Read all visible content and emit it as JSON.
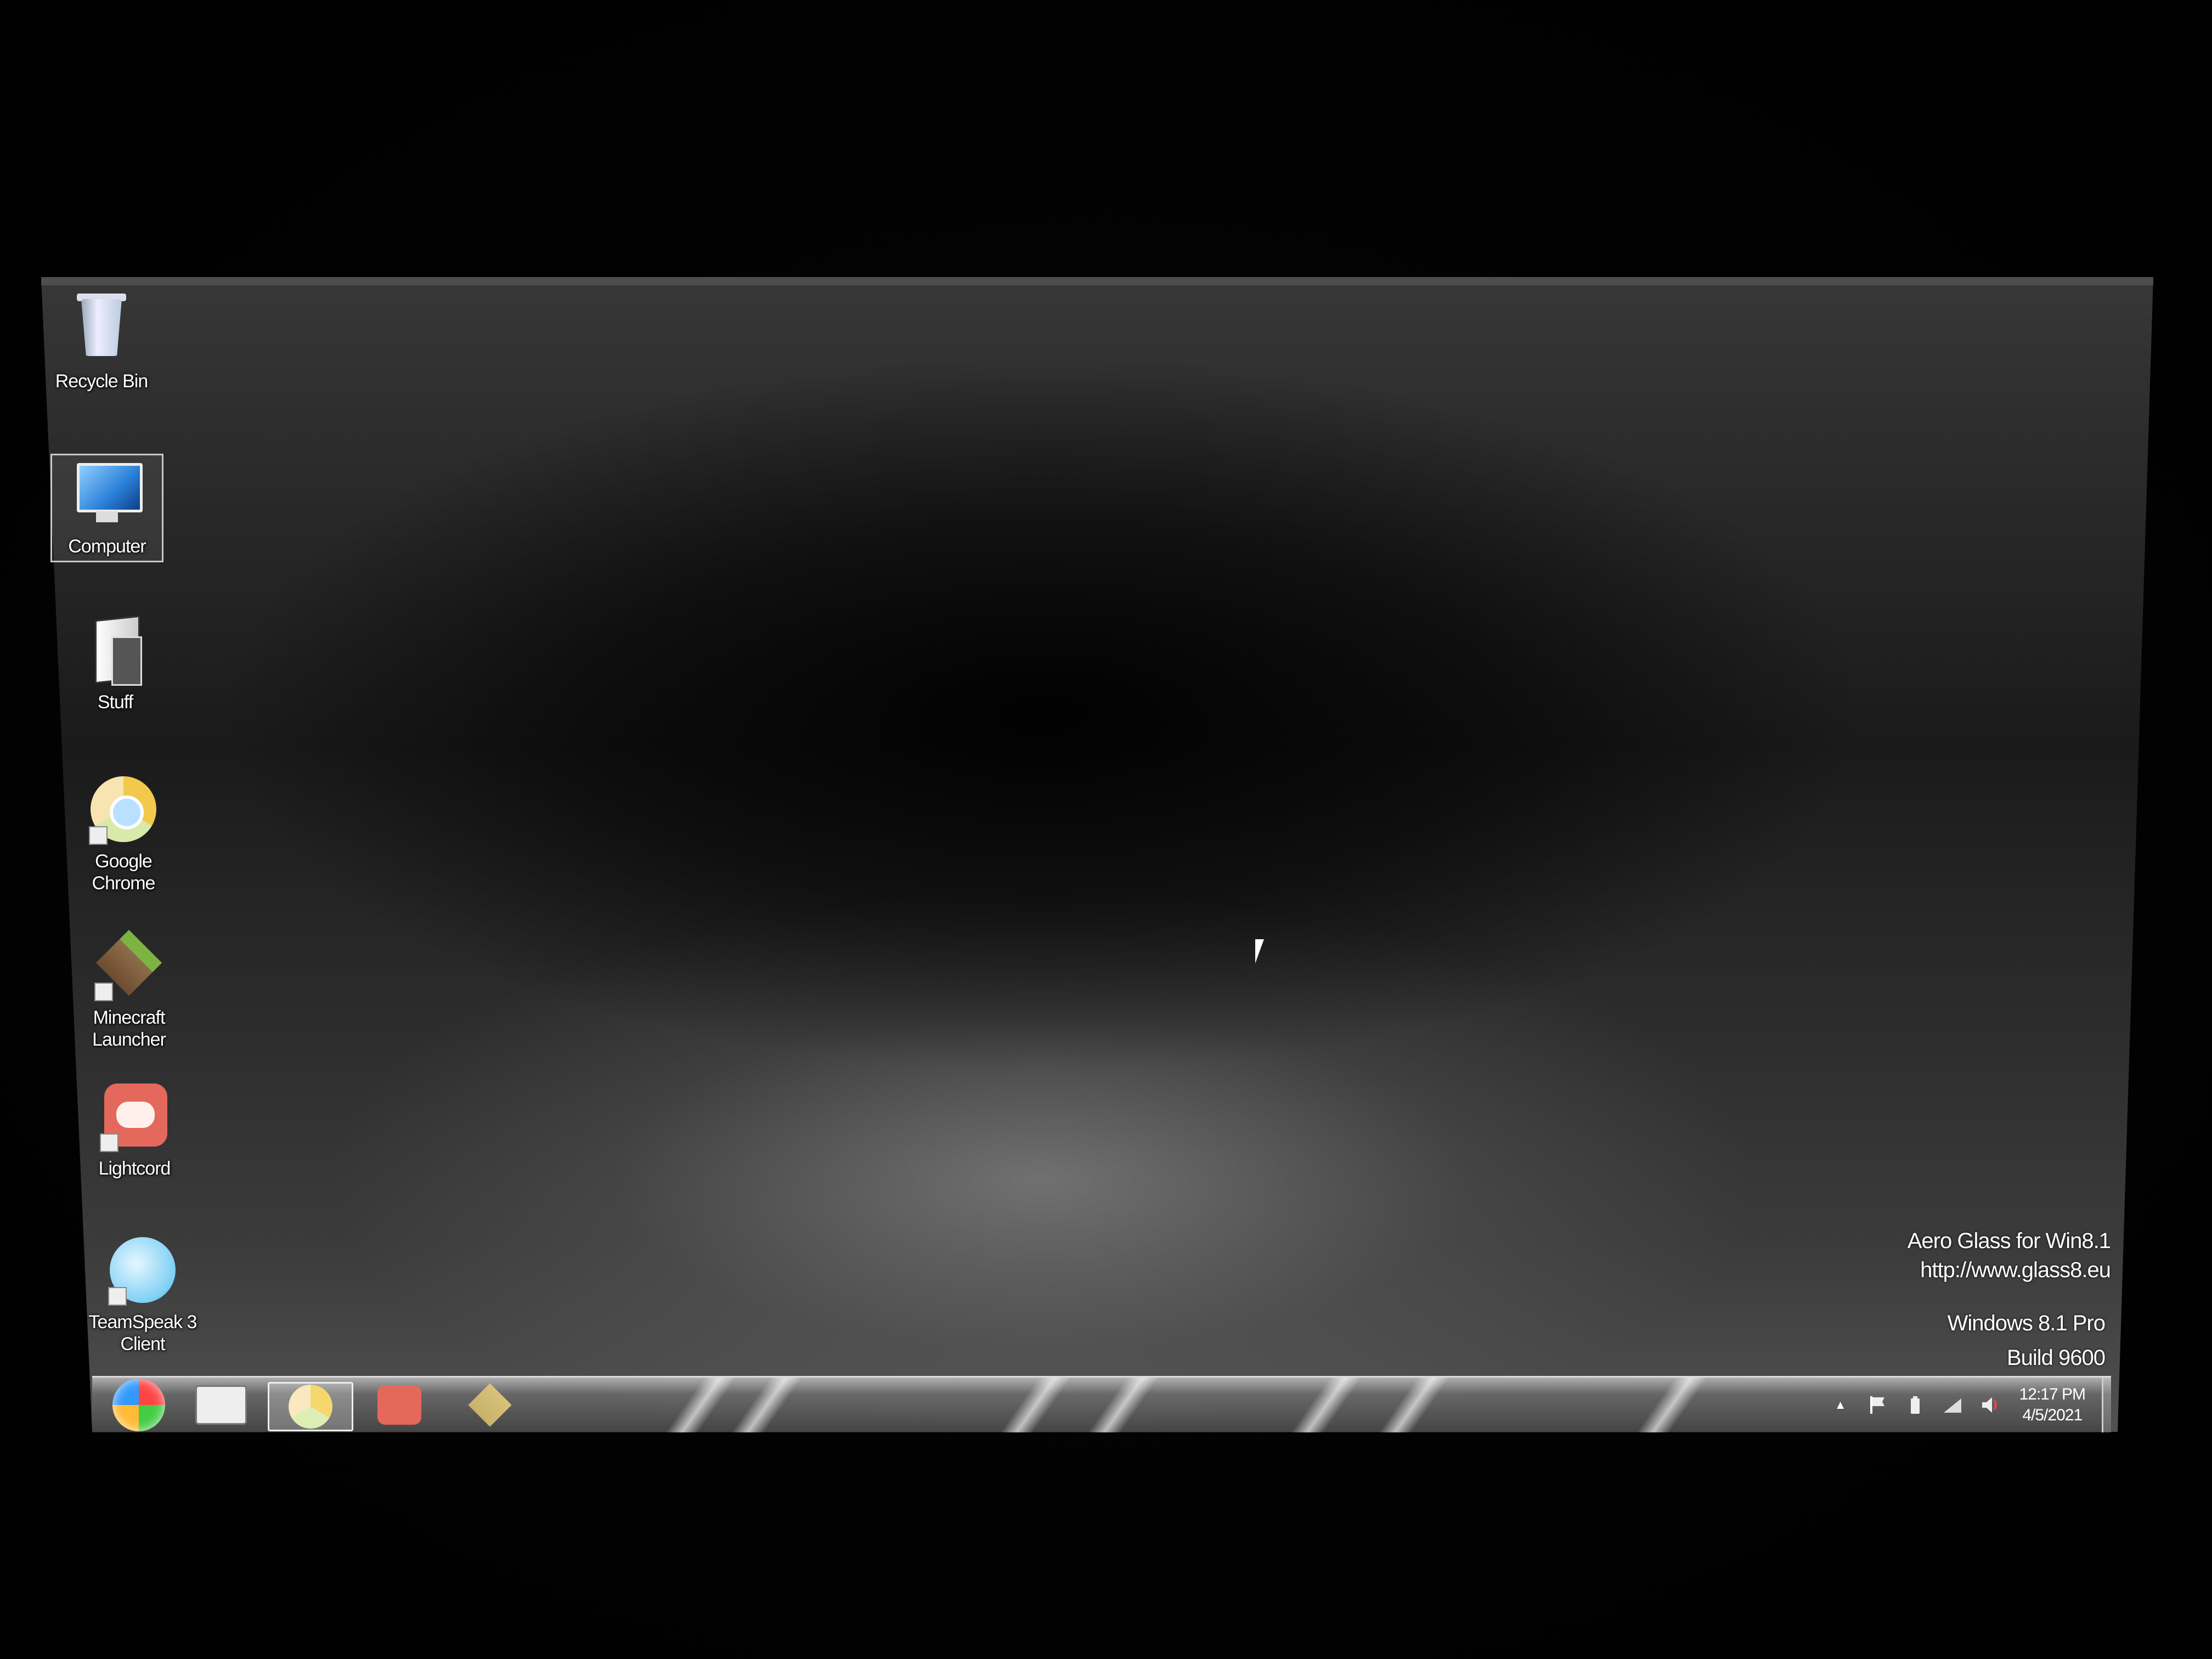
{
  "desktop": {
    "icons": [
      {
        "label": "Recycle Bin",
        "icon": "recycle-bin-icon"
      },
      {
        "label": "Computer",
        "icon": "computer-icon",
        "selected": true
      },
      {
        "label": "Stuff",
        "icon": "folder-shortcut-icon"
      },
      {
        "label_line1": "Google",
        "label_line2": "Chrome",
        "icon": "chrome-icon"
      },
      {
        "label_line1": "Minecraft",
        "label_line2": "Launcher",
        "icon": "minecraft-icon"
      },
      {
        "label": "Lightcord",
        "icon": "discord-icon"
      },
      {
        "label_line1": "TeamSpeak 3",
        "label_line2": "Client",
        "icon": "teamspeak-icon"
      }
    ],
    "watermark": {
      "line1": "Aero Glass for Win8.1",
      "line2": "http://www.glass8.eu",
      "line3": "Windows 8.1 Pro",
      "line4": "Build 9600"
    }
  },
  "taskbar": {
    "items": [
      {
        "name": "start-orb",
        "icon": "windows-orb-icon"
      },
      {
        "name": "file-explorer",
        "icon": "folder-icon"
      },
      {
        "name": "google-chrome",
        "icon": "chrome-icon",
        "active": true
      },
      {
        "name": "lightcord",
        "icon": "discord-icon"
      },
      {
        "name": "minecraft-launcher",
        "icon": "minecraft-icon"
      }
    ],
    "tray": {
      "chevron": "▲",
      "icons": [
        "flag-icon",
        "battery-icon",
        "network-icon",
        "volume-icon"
      ],
      "time": "12:17 PM",
      "date": "4/5/2021"
    }
  }
}
